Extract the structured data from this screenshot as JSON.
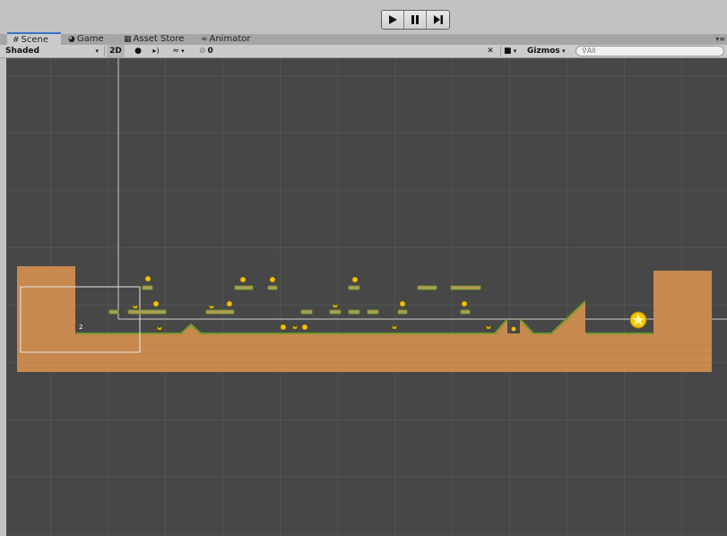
{
  "tabs": [
    {
      "label": "Scene",
      "icon": "grid-icon",
      "active": true
    },
    {
      "label": "Game",
      "icon": "pacman-icon",
      "active": false
    },
    {
      "label": "Asset Store",
      "icon": "store-icon",
      "active": false
    },
    {
      "label": "Animator",
      "icon": "animator-icon",
      "active": false
    }
  ],
  "toolbar": {
    "shading_mode": "Shaded",
    "mode_2d": "2D",
    "hidden_count": "0",
    "gizmos": "Gizmos",
    "search_placeholder": "All"
  },
  "scene_label": "2",
  "colors": {
    "background": "#474747",
    "ground": "#c8894f",
    "grass": "#6d9a2a",
    "platform": "#b59a5a",
    "coin": "#f2c200",
    "goal": "#f5c400",
    "guide_line": "#d0d0d0"
  }
}
